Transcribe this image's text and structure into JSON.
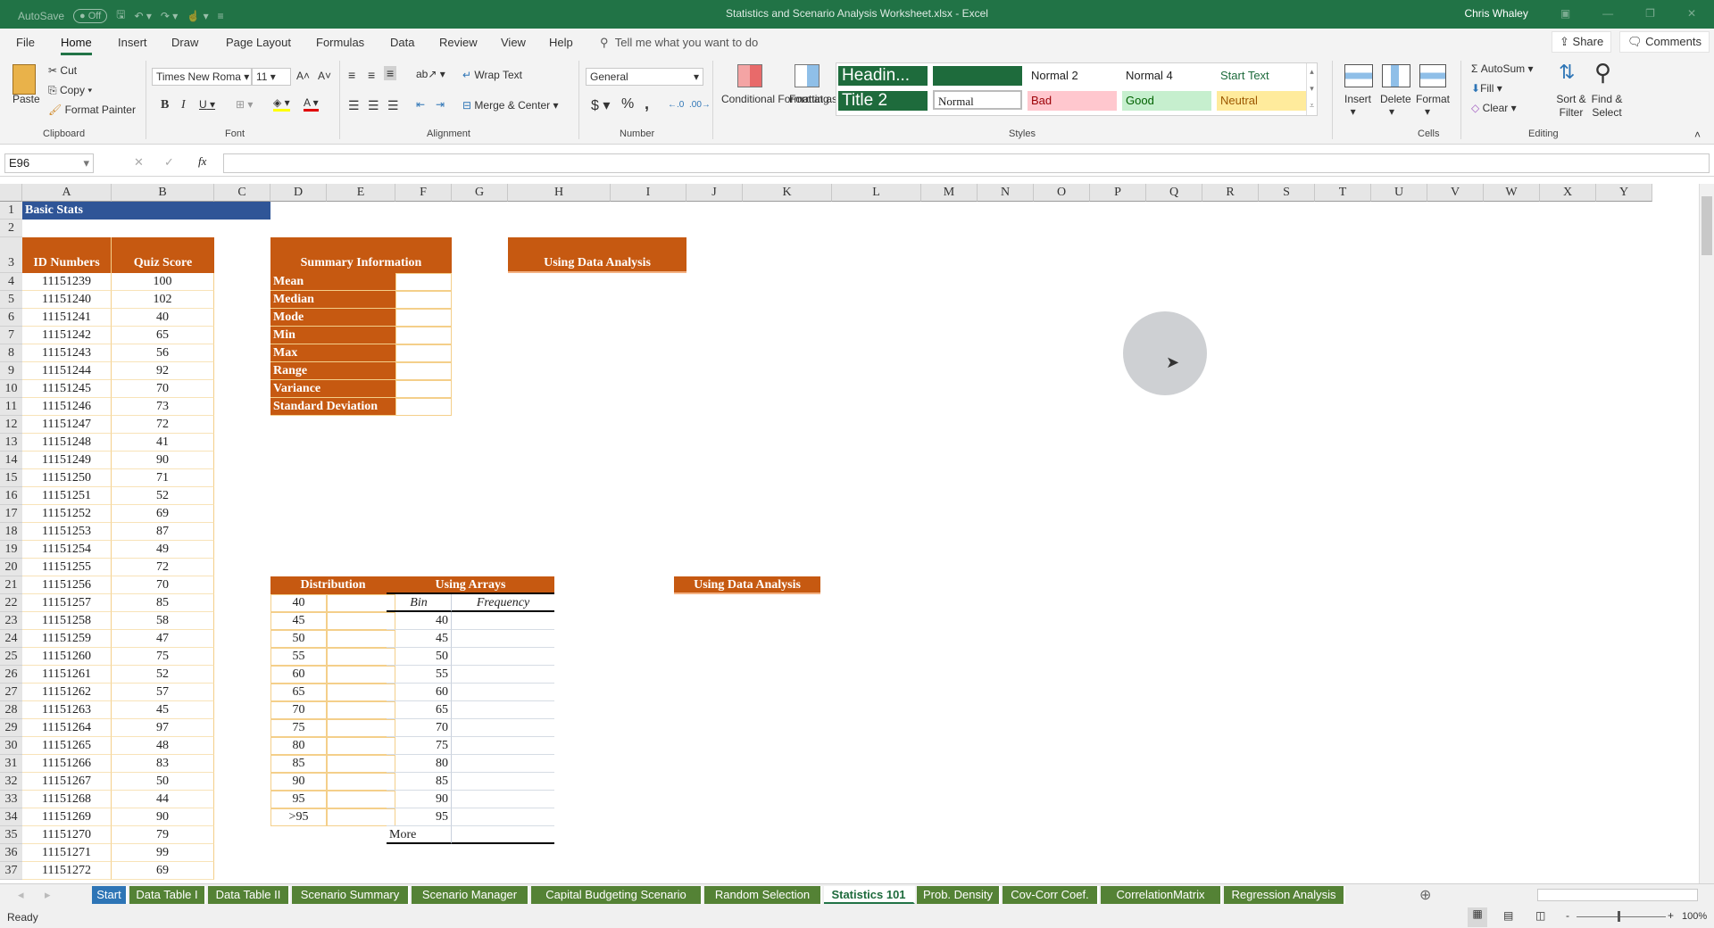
{
  "titlebar": {
    "autosave_label": "AutoSave",
    "autosave_state": "Off",
    "title": "Statistics and Scenario Analysis Worksheet.xlsx  -  Excel",
    "user": "Chris Whaley"
  },
  "menu": {
    "items": [
      "File",
      "Home",
      "Insert",
      "Draw",
      "Page Layout",
      "Formulas",
      "Data",
      "Review",
      "View",
      "Help"
    ],
    "active": "Home",
    "tell_me": "Tell me what you want to do",
    "share": "Share",
    "comments": "Comments"
  },
  "ribbon": {
    "clipboard": {
      "paste": "Paste",
      "cut": "Cut",
      "copy": "Copy",
      "format_painter": "Format Painter",
      "label": "Clipboard"
    },
    "font": {
      "name": "Times New Roma",
      "size": "11",
      "label": "Font",
      "bold": "B",
      "italic": "I",
      "underline": "U"
    },
    "alignment": {
      "wrap_text": "Wrap Text",
      "merge_center": "Merge & Center",
      "label": "Alignment"
    },
    "number": {
      "format": "General",
      "label": "Number",
      "currency": "$",
      "percent": "%",
      "comma": ","
    },
    "styles": {
      "conditional_formatting": "Conditional Formatting",
      "format_as_table": "Format as Table",
      "cells": [
        {
          "label": "Headin...",
          "bg": "#1e6b3c",
          "fg": "#ffffff"
        },
        {
          "label": "",
          "bg": "#1e6b3c",
          "fg": "#ffffff"
        },
        {
          "label": "Normal 2",
          "bg": "#ffffff",
          "fg": "#222222"
        },
        {
          "label": "Normal 4",
          "bg": "#ffffff",
          "fg": "#222222"
        },
        {
          "label": "Start Text",
          "bg": "#ffffff",
          "fg": "#1e6b3c"
        },
        {
          "label": "Title 2",
          "bg": "#1e6b3c",
          "fg": "#ffffff"
        },
        {
          "label": "Normal",
          "bg": "#ffffff",
          "fg": "#111111"
        },
        {
          "label": "Bad",
          "bg": "#ffc7ce",
          "fg": "#9c0006"
        },
        {
          "label": "Good",
          "bg": "#c6efce",
          "fg": "#006100"
        },
        {
          "label": "Neutral",
          "bg": "#ffeb9c",
          "fg": "#9c5700"
        }
      ],
      "label": "Styles"
    },
    "cells": {
      "insert": "Insert",
      "delete": "Delete",
      "format": "Format",
      "label": "Cells"
    },
    "editing": {
      "autosum": "AutoSum",
      "fill": "Fill",
      "clear": "Clear",
      "sort_filter": "Sort & Filter",
      "find_select": "Find & Select",
      "label": "Editing"
    }
  },
  "formula_bar": {
    "name_box": "E96",
    "formula": "",
    "fx": "fx"
  },
  "columns": [
    "A",
    "B",
    "C",
    "D",
    "E",
    "F",
    "G",
    "H",
    "I",
    "J",
    "K",
    "L",
    "M",
    "N",
    "O",
    "P",
    "Q",
    "R",
    "S",
    "T",
    "U",
    "V",
    "W",
    "X",
    "Y"
  ],
  "sheet": {
    "title": "Basic Stats",
    "id_header": "ID Numbers",
    "score_header": "Quiz Score",
    "records": [
      [
        "11151239",
        "100"
      ],
      [
        "11151240",
        "102"
      ],
      [
        "11151241",
        "40"
      ],
      [
        "11151242",
        "65"
      ],
      [
        "11151243",
        "56"
      ],
      [
        "11151244",
        "92"
      ],
      [
        "11151245",
        "70"
      ],
      [
        "11151246",
        "73"
      ],
      [
        "11151247",
        "72"
      ],
      [
        "11151248",
        "41"
      ],
      [
        "11151249",
        "90"
      ],
      [
        "11151250",
        "71"
      ],
      [
        "11151251",
        "52"
      ],
      [
        "11151252",
        "69"
      ],
      [
        "11151253",
        "87"
      ],
      [
        "11151254",
        "49"
      ],
      [
        "11151255",
        "72"
      ],
      [
        "11151256",
        "70"
      ],
      [
        "11151257",
        "85"
      ],
      [
        "11151258",
        "58"
      ],
      [
        "11151259",
        "47"
      ],
      [
        "11151260",
        "75"
      ],
      [
        "11151261",
        "52"
      ],
      [
        "11151262",
        "57"
      ],
      [
        "11151263",
        "45"
      ],
      [
        "11151264",
        "97"
      ],
      [
        "11151265",
        "48"
      ],
      [
        "11151266",
        "83"
      ],
      [
        "11151267",
        "50"
      ],
      [
        "11151268",
        "44"
      ],
      [
        "11151269",
        "90"
      ],
      [
        "11151270",
        "79"
      ],
      [
        "11151271",
        "99"
      ],
      [
        "11151272",
        "69"
      ]
    ],
    "summary_header": "Summary Information",
    "summary_items": [
      "Mean",
      "Median",
      "Mode",
      "Min",
      "Max",
      "Range",
      "Variance",
      "Standard Deviation"
    ],
    "data_analysis_header": "Using Data Analysis",
    "distribution_header": "Distribution",
    "distribution_bins": [
      "40",
      "45",
      "50",
      "55",
      "60",
      "65",
      "70",
      "75",
      "80",
      "85",
      "90",
      "95",
      ">95"
    ],
    "arrays_header": "Using Arrays",
    "arrays_bin_label": "Bin",
    "arrays_freq_label": "Frequency",
    "arrays_bins": [
      "40",
      "45",
      "50",
      "55",
      "60",
      "65",
      "70",
      "75",
      "80",
      "85",
      "90",
      "95"
    ],
    "arrays_more": "More",
    "data_analysis_header_2": "Using Data Analysis"
  },
  "sheet_tabs": [
    "Start",
    "Data Table I",
    "Data Table II",
    "Scenario Summary",
    "Scenario Manager",
    "Capital Budgeting Scenario",
    "Random Selection",
    "Statistics 101",
    "Prob. Density",
    "Cov-Corr Coef.",
    "CorrelationMatrix",
    "Regression Analysis"
  ],
  "active_tab": "Statistics 101",
  "status": {
    "ready": "Ready",
    "zoom": "100%"
  }
}
